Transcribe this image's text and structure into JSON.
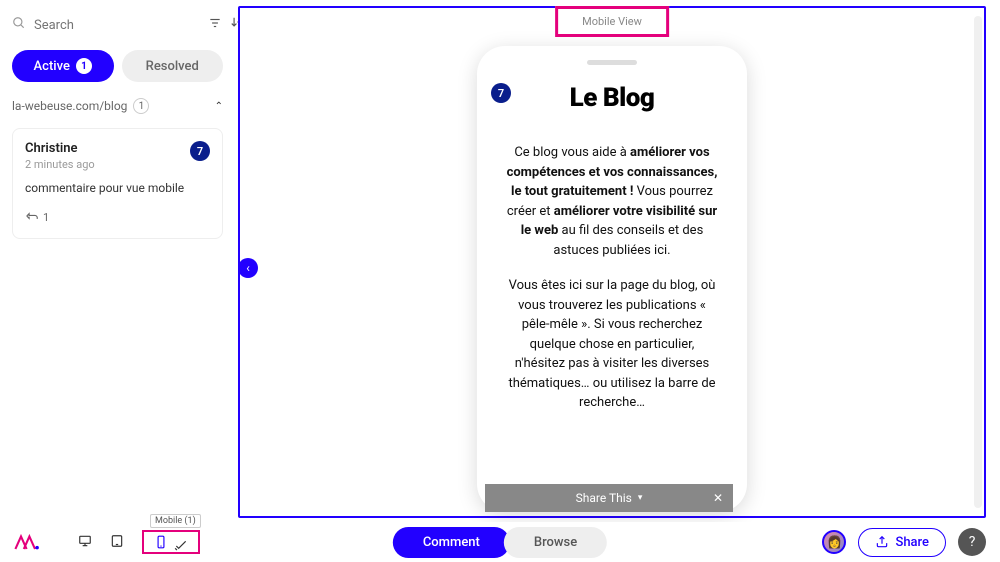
{
  "search": {
    "placeholder": "Search"
  },
  "tabs": {
    "active_label": "Active",
    "active_count": "1",
    "resolved_label": "Resolved"
  },
  "page_group": {
    "name": "la-webeuse.com/blog",
    "count": "1"
  },
  "comment": {
    "author": "Christine",
    "time": "2 minutes ago",
    "badge": "7",
    "text": "commentaire pour vue mobile",
    "reply_count": "1"
  },
  "viewport": {
    "label": "Mobile View",
    "marker": "7"
  },
  "blog": {
    "title": "Le Blog",
    "p1_a": "Ce blog vous aide à ",
    "p1_b1": "améliorer vos compétences et vos connaissances, le tout gratuitement !",
    "p1_c": " Vous pourrez créer et ",
    "p1_b2": "améliorer votre visibilité sur le web",
    "p1_d": " au fil des conseils et des astuces publiées ici.",
    "p2": "Vous êtes ici sur la page du blog, où vous trouverez les publications « pêle-mêle ». Si vous recherchez quelque chose en particulier, n'hésitez pas à visiter les diverses thématiques… ou utilisez la barre de recherche…",
    "share_label": "Share This"
  },
  "bottom": {
    "mobile_tooltip": "Mobile (1)",
    "comment_btn": "Comment",
    "browse_btn": "Browse",
    "share_btn": "Share"
  }
}
